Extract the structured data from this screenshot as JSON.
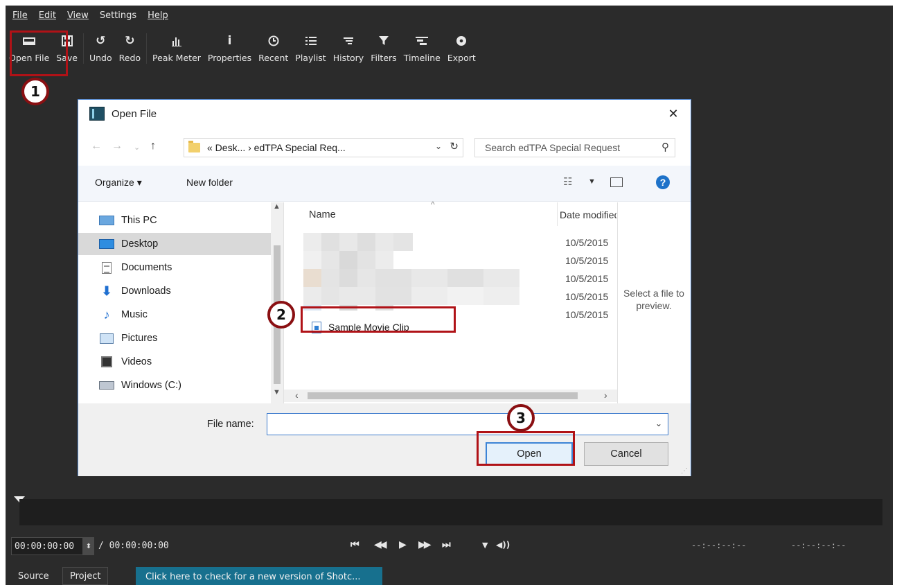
{
  "menu": [
    {
      "label": "File",
      "ul": true
    },
    {
      "label": "Edit",
      "ul": true
    },
    {
      "label": "View",
      "ul": true
    },
    {
      "label": "Settings",
      "ul": false
    },
    {
      "label": "Help",
      "ul": true
    }
  ],
  "toolbar": {
    "open_file": {
      "label": "Open File",
      "icon": "open-file-icon"
    },
    "save": {
      "label": "Save",
      "icon": "save-icon"
    },
    "undo": {
      "label": "Undo",
      "icon": "undo-icon"
    },
    "redo": {
      "label": "Redo",
      "icon": "redo-icon"
    },
    "peak_meter": {
      "label": "Peak Meter",
      "icon": "peak-meter-icon"
    },
    "properties": {
      "label": "Properties",
      "icon": "info-icon"
    },
    "recent": {
      "label": "Recent",
      "icon": "clock-icon"
    },
    "playlist": {
      "label": "Playlist",
      "icon": "list-icon"
    },
    "history": {
      "label": "History",
      "icon": "history-icon"
    },
    "filters": {
      "label": "Filters",
      "icon": "funnel-icon"
    },
    "timeline": {
      "label": "Timeline",
      "icon": "timeline-icon"
    },
    "export": {
      "label": "Export",
      "icon": "disc-icon"
    }
  },
  "annotations": {
    "step1": "1",
    "step2": "2",
    "step3": "3",
    "color": "#b01217"
  },
  "dialog": {
    "title": "Open File",
    "close_glyph": "✕",
    "address": {
      "path": "« Desk... › edTPA Special Req...",
      "refresh_glyph": "↻"
    },
    "search": {
      "placeholder": "Search edTPA Special Request"
    },
    "commands": {
      "organize": "Organize ▾",
      "new_folder": "New folder",
      "help": "?"
    },
    "nav": [
      {
        "label": "This PC",
        "icon": "this-pc-icon"
      },
      {
        "label": "Desktop",
        "icon": "desktop-icon",
        "selected": true
      },
      {
        "label": "Documents",
        "icon": "documents-icon"
      },
      {
        "label": "Downloads",
        "icon": "downloads-icon"
      },
      {
        "label": "Music",
        "icon": "music-icon"
      },
      {
        "label": "Pictures",
        "icon": "pictures-icon"
      },
      {
        "label": "Videos",
        "icon": "videos-icon"
      },
      {
        "label": "Windows (C:)",
        "icon": "drive-icon"
      }
    ],
    "columns": {
      "name": "Name",
      "date": "Date modified"
    },
    "dates": [
      "10/5/2015",
      "10/5/2015",
      "10/5/2015",
      "10/5/2015",
      "10/5/2015"
    ],
    "file": {
      "name": "Sample Movie Clip",
      "icon": "video-file-icon"
    },
    "preview_text": "Select a file to preview.",
    "file_name_label": "File name:",
    "file_name_value": "",
    "open_label": "Open",
    "cancel_label": "Cancel"
  },
  "transport": {
    "timecode": "00:00:00:00",
    "total": "/ 00:00:00:00",
    "in_point": "--:--:--:--",
    "out_point": "--:--:--:--"
  },
  "tabs": {
    "source": "Source",
    "project": "Project",
    "update": "Click here to check for a new version of Shotc..."
  }
}
